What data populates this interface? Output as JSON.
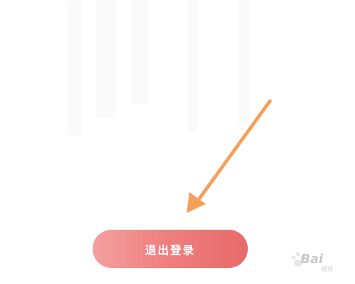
{
  "logout_button": {
    "label": "退出登录"
  },
  "annotation": {
    "arrow_color": "#f5a05a"
  },
  "watermark": {
    "brand": "Bai",
    "sub": "经验"
  },
  "colors": {
    "button_gradient_start": "#f5a0a0",
    "button_gradient_end": "#e86a6a",
    "arrow": "#f5a05a"
  }
}
